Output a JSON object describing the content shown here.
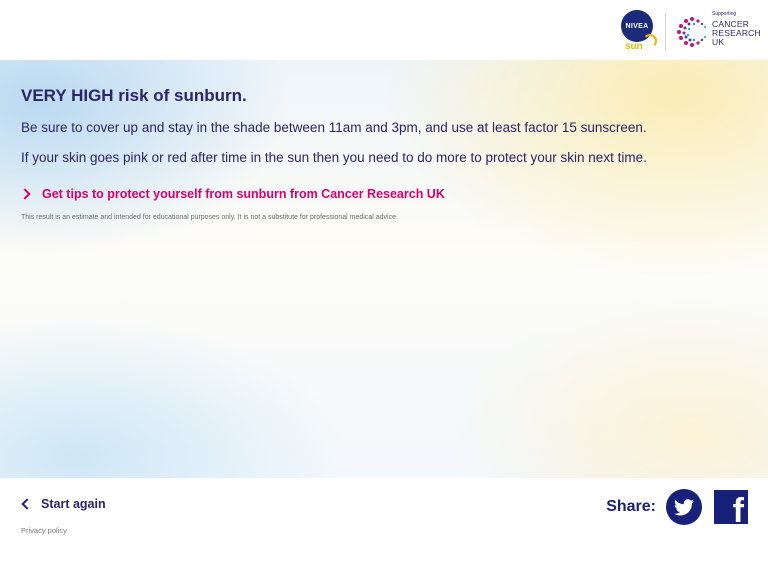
{
  "header": {
    "nivea_logo_text": "NIVEA",
    "nivea_sun_text": "sun",
    "cru_supporting": "Supporting",
    "cru_line1": "CANCER",
    "cru_line2": "RESEARCH",
    "cru_line3": "UK"
  },
  "result": {
    "headline": "VERY HIGH risk of sunburn.",
    "paragraph1": "Be sure to cover up and stay in the shade between 11am and 3pm, and use at least factor 15 sunscreen.",
    "paragraph2": "If your skin goes pink or red after time in the sun then you need to do more to protect your skin next time.",
    "tips_link": "Get tips to protect yourself from sunburn from Cancer Research UK",
    "disclaimer": "This result is an estimate and intended for educational purposes only. It is not a substitute for professional medical advice."
  },
  "footer": {
    "start_again": "Start again",
    "privacy": "Privacy policy",
    "share_label": "Share:"
  },
  "colors": {
    "brand_navy": "#2a2468",
    "link_pink": "#d6006f",
    "social_navy": "#18217a",
    "sun_yellow": "#f2b600"
  },
  "icons": [
    "nivea-logo",
    "cancer-research-uk-logo",
    "chevron-right-icon",
    "chevron-left-icon",
    "twitter-icon",
    "facebook-icon"
  ]
}
